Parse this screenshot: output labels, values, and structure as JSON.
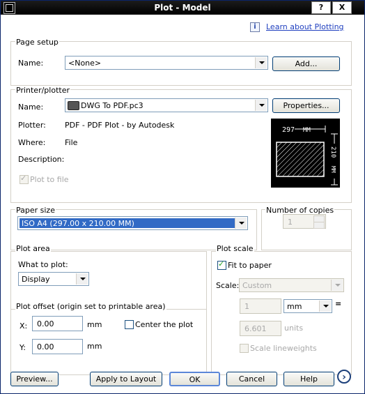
{
  "window": {
    "title": "Plot - Model",
    "help_btn": "?",
    "close_btn": "X"
  },
  "learn_link": "Learn about Plotting",
  "page_setup": {
    "group": "Page setup",
    "name_label": "Name:",
    "name_value": "<None>",
    "add_button": "Add..."
  },
  "printer": {
    "group": "Printer/plotter",
    "name_label": "Name:",
    "name_value": "DWG To PDF.pc3",
    "properties_button": "Properties...",
    "plotter_label": "Plotter:",
    "plotter_value": "PDF - PDF Plot - by Autodesk",
    "where_label": "Where:",
    "where_value": "File",
    "description_label": "Description:",
    "plot_to_file_label": "Plot to file",
    "plot_to_file_checked": true,
    "preview_width": "297",
    "preview_height": "210",
    "preview_unit": "MM"
  },
  "paper_size": {
    "group": "Paper size",
    "value": "ISO A4 (297.00 x 210.00 MM)"
  },
  "copies": {
    "group": "Number of copies",
    "value": "1"
  },
  "plot_area": {
    "group": "Plot area",
    "what_label": "What to plot:",
    "what_value": "Display"
  },
  "plot_offset": {
    "group": "Plot offset (origin set to printable area)",
    "x_label": "X:",
    "x_value": "0.00",
    "x_unit": "mm",
    "y_label": "Y:",
    "y_value": "0.00",
    "y_unit": "mm",
    "center_label": "Center the plot"
  },
  "plot_scale": {
    "group": "Plot scale",
    "fit_label": "Fit to paper",
    "fit_checked": true,
    "scale_label": "Scale:",
    "scale_value": "Custom",
    "value1": "1",
    "unit_value": "mm",
    "equals": "=",
    "value2": "6.601",
    "units_label": "units",
    "lineweights_label": "Scale lineweights"
  },
  "footer": {
    "preview": "Preview...",
    "apply": "Apply to Layout",
    "ok": "OK",
    "cancel": "Cancel",
    "help": "Help"
  }
}
